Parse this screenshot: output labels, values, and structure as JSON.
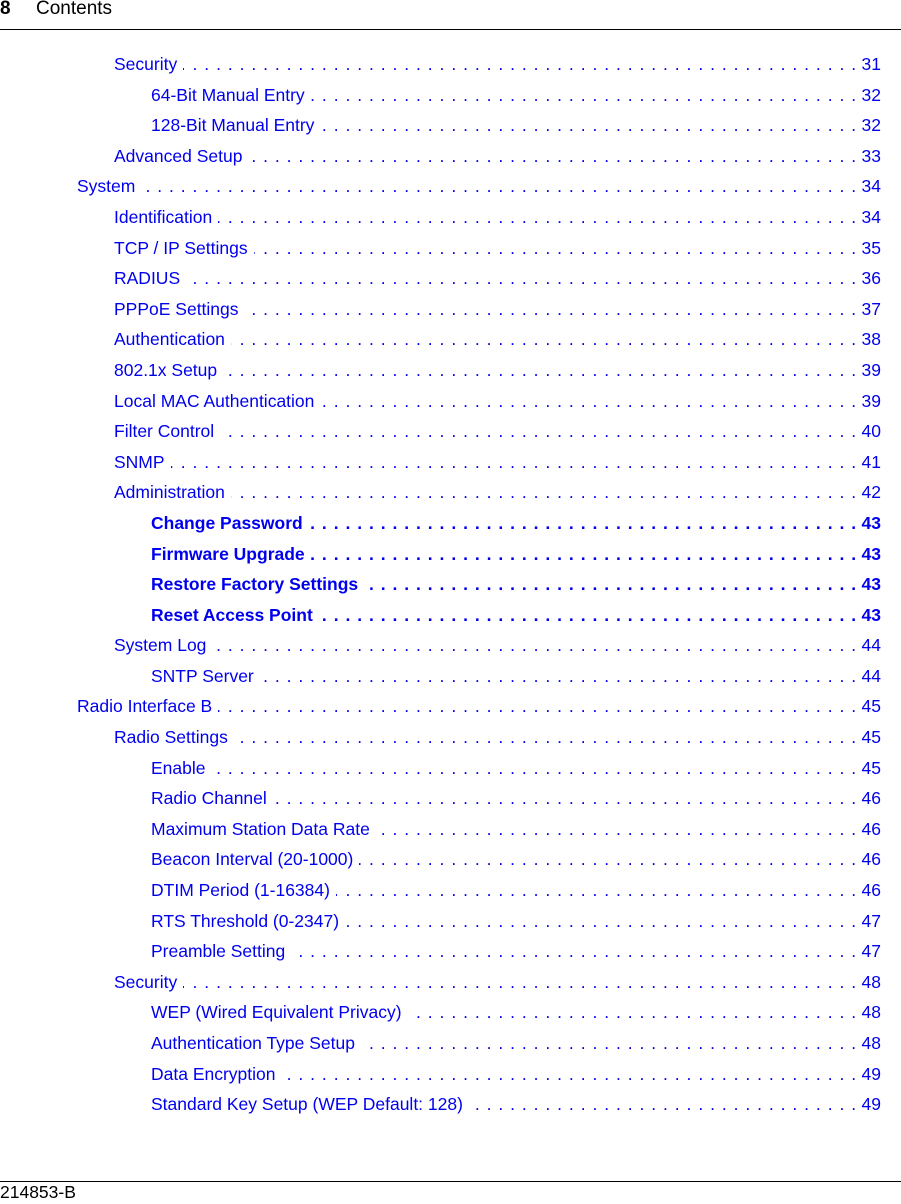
{
  "header": {
    "chapter_number": "8",
    "title": "Contents"
  },
  "footer": {
    "doc_id": "214853-B"
  },
  "link_color": "#0000ee",
  "toc": [
    {
      "label": "Security",
      "page": "31",
      "level": 1,
      "bold": false
    },
    {
      "label": "64-Bit Manual Entry",
      "page": "32",
      "level": 2,
      "bold": false
    },
    {
      "label": "128-Bit Manual Entry",
      "page": "32",
      "level": 2,
      "bold": false
    },
    {
      "label": "Advanced Setup",
      "page": "33",
      "level": 1,
      "bold": false
    },
    {
      "label": "System",
      "page": "34",
      "level": 0,
      "bold": false
    },
    {
      "label": "Identification",
      "page": "34",
      "level": 1,
      "bold": false
    },
    {
      "label": "TCP / IP Settings",
      "page": "35",
      "level": 1,
      "bold": false
    },
    {
      "label": "RADIUS",
      "page": "36",
      "level": 1,
      "bold": false
    },
    {
      "label": "PPPoE Settings",
      "page": "37",
      "level": 1,
      "bold": false
    },
    {
      "label": "Authentication",
      "page": "38",
      "level": 1,
      "bold": false
    },
    {
      "label": "802.1x Setup",
      "page": "39",
      "level": 1,
      "bold": false
    },
    {
      "label": "Local MAC Authentication",
      "page": "39",
      "level": 1,
      "bold": false
    },
    {
      "label": "Filter Control",
      "page": "40",
      "level": 1,
      "bold": false
    },
    {
      "label": "SNMP",
      "page": "41",
      "level": 1,
      "bold": false
    },
    {
      "label": "Administration",
      "page": "42",
      "level": 1,
      "bold": false
    },
    {
      "label": "Change Password",
      "page": "43",
      "level": 2,
      "bold": true
    },
    {
      "label": "Firmware Upgrade",
      "page": "43",
      "level": 2,
      "bold": true
    },
    {
      "label": "Restore Factory Settings",
      "page": "43",
      "level": 2,
      "bold": true
    },
    {
      "label": "Reset Access Point",
      "page": "43",
      "level": 2,
      "bold": true
    },
    {
      "label": "System Log",
      "page": "44",
      "level": 1,
      "bold": false
    },
    {
      "label": "SNTP Server",
      "page": "44",
      "level": 2,
      "bold": false
    },
    {
      "label": "Radio Interface B",
      "page": "45",
      "level": 0,
      "bold": false
    },
    {
      "label": "Radio Settings",
      "page": "45",
      "level": 1,
      "bold": false
    },
    {
      "label": "Enable",
      "page": "45",
      "level": 2,
      "bold": false
    },
    {
      "label": "Radio Channel",
      "page": "46",
      "level": 2,
      "bold": false
    },
    {
      "label": "Maximum Station Data Rate",
      "page": "46",
      "level": 2,
      "bold": false
    },
    {
      "label": "Beacon Interval (20-1000)",
      "page": "46",
      "level": 2,
      "bold": false
    },
    {
      "label": "DTIM Period (1-16384)",
      "page": "46",
      "level": 2,
      "bold": false
    },
    {
      "label": "RTS Threshold (0-2347)",
      "page": "47",
      "level": 2,
      "bold": false
    },
    {
      "label": "Preamble Setting",
      "page": "47",
      "level": 2,
      "bold": false
    },
    {
      "label": "Security",
      "page": "48",
      "level": 1,
      "bold": false
    },
    {
      "label": "WEP (Wired Equivalent Privacy)",
      "page": "48",
      "level": 2,
      "bold": false
    },
    {
      "label": "Authentication Type Setup",
      "page": "48",
      "level": 2,
      "bold": false
    },
    {
      "label": "Data Encryption",
      "page": "49",
      "level": 2,
      "bold": false
    },
    {
      "label": "Standard Key Setup (WEP Default: 128)",
      "page": "49",
      "level": 2,
      "bold": false
    }
  ]
}
